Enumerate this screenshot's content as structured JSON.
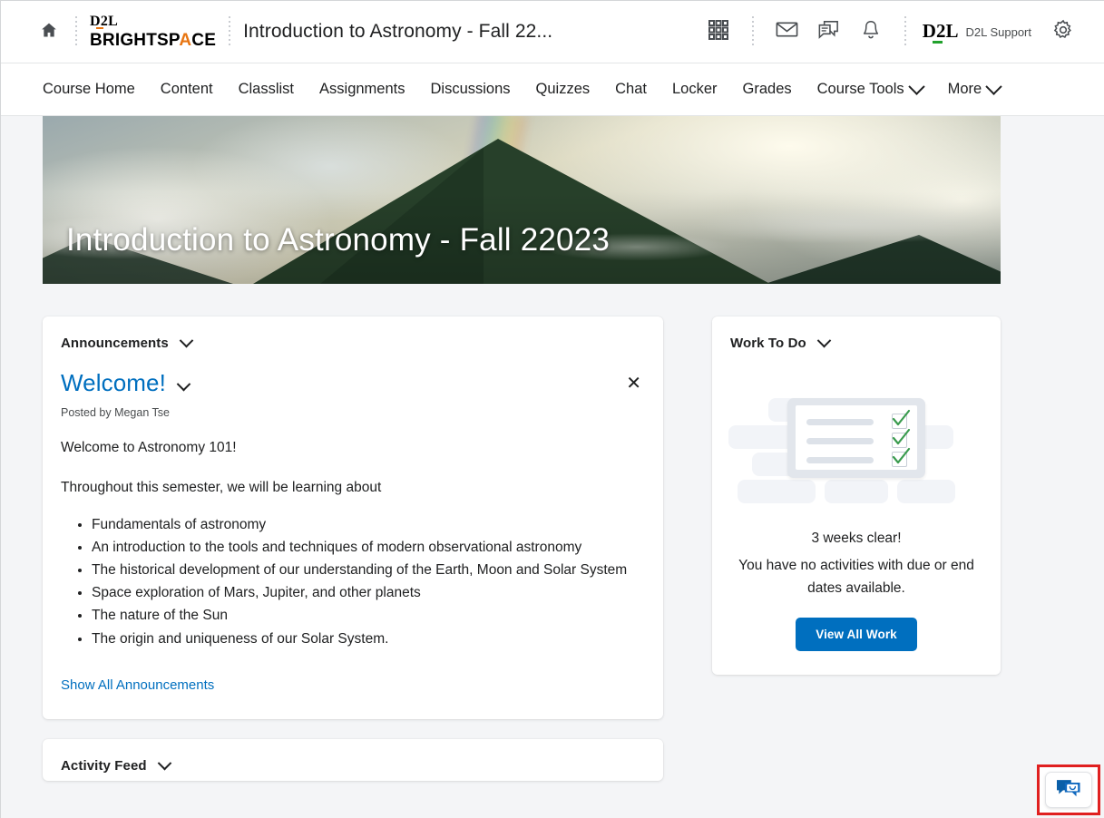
{
  "header": {
    "home_icon": "home-icon",
    "brand": {
      "top": "D2L",
      "bottom_a": "BRIGHTSP",
      "accent": "A",
      "bottom_b": "CE"
    },
    "course_title": "Introduction to Astronomy - Fall 22...",
    "icons": [
      "waffle-grid-icon",
      "envelope-icon",
      "chat-bubble-icon",
      "bell-icon",
      "gear-icon"
    ],
    "user": {
      "logo": "D2L",
      "name": "D2L Support"
    }
  },
  "nav": {
    "items": [
      {
        "label": "Course Home",
        "has_caret": false
      },
      {
        "label": "Content",
        "has_caret": false
      },
      {
        "label": "Classlist",
        "has_caret": false
      },
      {
        "label": "Assignments",
        "has_caret": false
      },
      {
        "label": "Discussions",
        "has_caret": false
      },
      {
        "label": "Quizzes",
        "has_caret": false
      },
      {
        "label": "Chat",
        "has_caret": false
      },
      {
        "label": "Locker",
        "has_caret": false
      },
      {
        "label": "Grades",
        "has_caret": false
      },
      {
        "label": "Course Tools",
        "has_caret": true
      },
      {
        "label": "More",
        "has_caret": true
      }
    ]
  },
  "hero": {
    "title": "Introduction to Astronomy - Fall 22023"
  },
  "announcements": {
    "widget_title": "Announcements",
    "item_title": "Welcome!",
    "close_label": "✕",
    "posted_by": "Posted by Megan Tse",
    "paragraph1": "Welcome to Astronomy 101!",
    "paragraph2": "Throughout this semester, we will be learning about",
    "bullets": [
      "Fundamentals of astronomy",
      "An introduction to the tools and techniques of modern observational astronomy",
      "The historical development of our understanding of the Earth, Moon and Solar System",
      "Space exploration of Mars, Jupiter, and other planets",
      "The nature of the Sun",
      "The origin and uniqueness of our Solar System."
    ],
    "show_all_link": "Show All Announcements"
  },
  "activity_feed": {
    "widget_title": "Activity Feed"
  },
  "work_to_do": {
    "widget_title": "Work To Do",
    "illustration": "checklist-board-illustration",
    "message_line1": "3 weeks clear!",
    "message_line2": "You have no activities with due or end dates available.",
    "button_label": "View All Work"
  },
  "chat_launcher": {
    "icon": "chat-smiley-icon"
  },
  "colors": {
    "accent_blue": "#006fbf",
    "brand_orange": "#e87511",
    "brand_green": "#21a12c",
    "highlight_red": "#e02020",
    "page_bg": "#f4f5f7"
  }
}
